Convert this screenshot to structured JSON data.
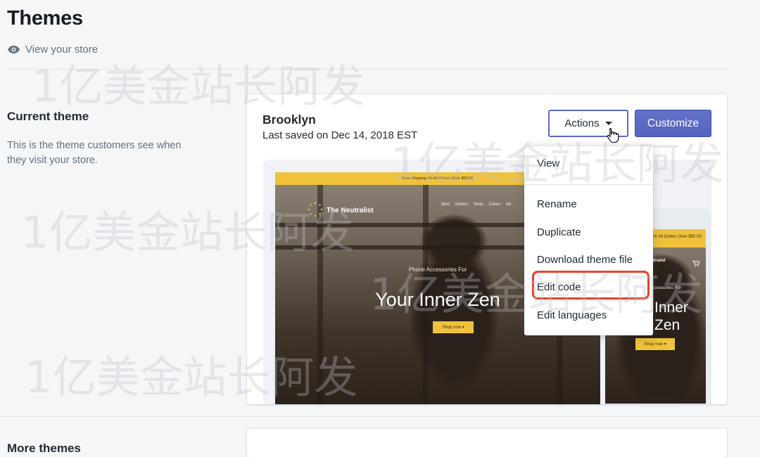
{
  "page": {
    "title": "Themes",
    "view_store": "View your store"
  },
  "current_theme": {
    "heading": "Current theme",
    "description": "This is the theme customers see when they visit your store.",
    "name": "Brooklyn",
    "saved": "Last saved on Dec 14, 2018 EST",
    "actions_label": "Actions",
    "customize_label": "Customize"
  },
  "actions_menu": {
    "items": [
      "View",
      "Rename",
      "Duplicate",
      "Download theme file",
      "Edit code",
      "Edit languages"
    ],
    "highlighted": "Edit code"
  },
  "preview": {
    "announcement": "Free Shipping On All Orders Over $50.00",
    "brand": "The Neutralist",
    "nav": "Best Sellers  Shop Cases  Ab",
    "eyebrow": "Phone Accessories For",
    "headline": "Your Inner Zen",
    "shop_button": "Shop now ▾",
    "phone_announcement": "On All Orders Over $50.00",
    "phone_brand": "Neutralist",
    "phone_eyebrow": "Accessories For",
    "phone_headline": "Inner Zen",
    "phone_shop_button": "Shop now ▾"
  },
  "more_themes": {
    "heading": "More themes"
  },
  "watermark": "1亿美金站长阿发",
  "colors": {
    "accent": "#5c6ac4",
    "highlight_border": "#e6412d",
    "preview_bar": "#f0c23b"
  },
  "icons": {
    "view_store": "eye-icon",
    "actions_caret": "caret-down-icon",
    "cursor": "hand-pointer-icon"
  }
}
